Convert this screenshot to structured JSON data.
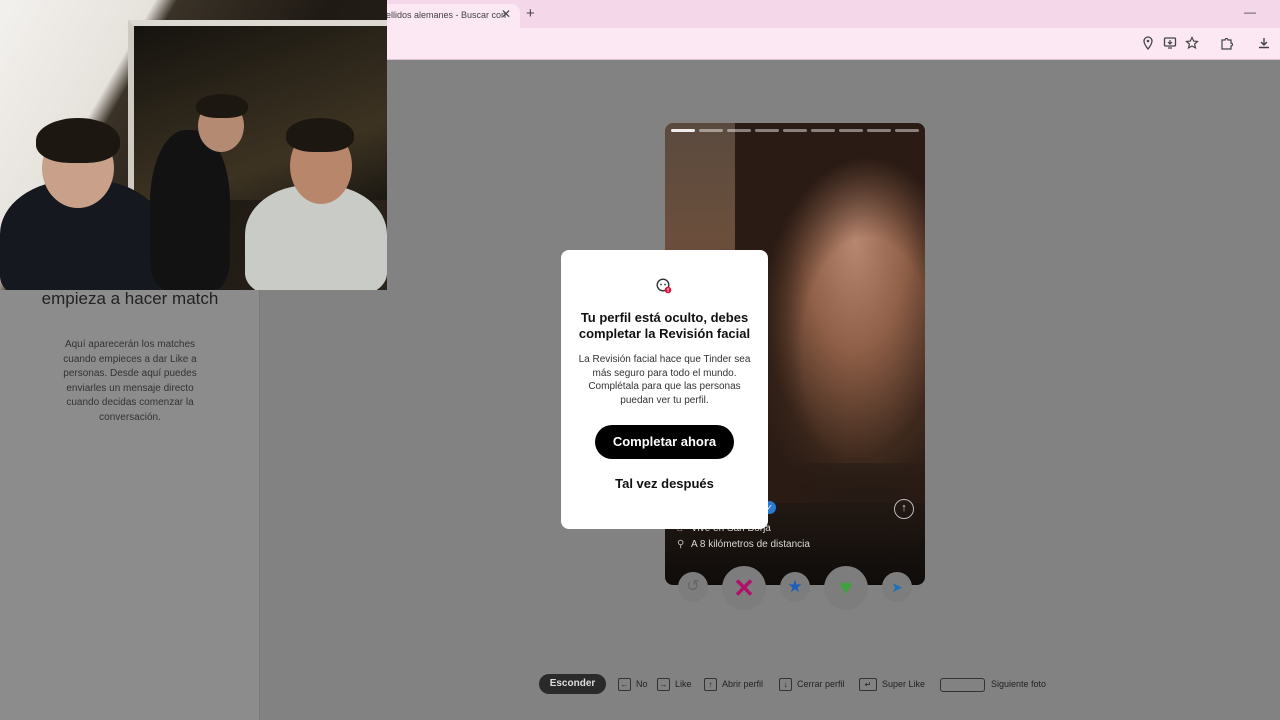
{
  "browser": {
    "tab_title": "ellidos alemanes - Buscar con",
    "tab_close": "✕",
    "new_tab": "+",
    "minimize": "—"
  },
  "left_panel": {
    "empty_title": "empieza a hacer match",
    "empty_description": "Aquí aparecerán los matches cuando empieces a dar Like a personas. Desde aquí puedes enviarles un mensaje directo cuando decidas comenzar la conversación."
  },
  "card": {
    "info_home": "Vive en San Borja",
    "info_distance": "A 8 kilómetros de distancia"
  },
  "modal": {
    "title": "Tu perfil está oculto, debes completar la Revisión facial",
    "description": "La Revisión facial hace que Tinder sea más seguro para todo el mundo. Complétala para que las personas puedan ver tu perfil.",
    "primary_button": "Completar ahora",
    "secondary_button": "Tal vez después"
  },
  "shortcuts": {
    "hide": "Esconder",
    "no": "No",
    "like": "Like",
    "open_profile": "Abrir perfil",
    "close_profile": "Cerrar perfil",
    "super_like": "Super Like",
    "next_photo": "Siguiente foto"
  },
  "icons": {
    "location": "location-icon",
    "install": "install-app-icon",
    "bookmark": "star-icon",
    "extensions": "puzzle-icon",
    "download": "download-icon"
  },
  "colors": {
    "tab_bar": "#f5d7ea",
    "nope": "#b0106a",
    "super_like": "#1d5fb8",
    "like": "#3da43d",
    "primary_button": "#000000"
  }
}
